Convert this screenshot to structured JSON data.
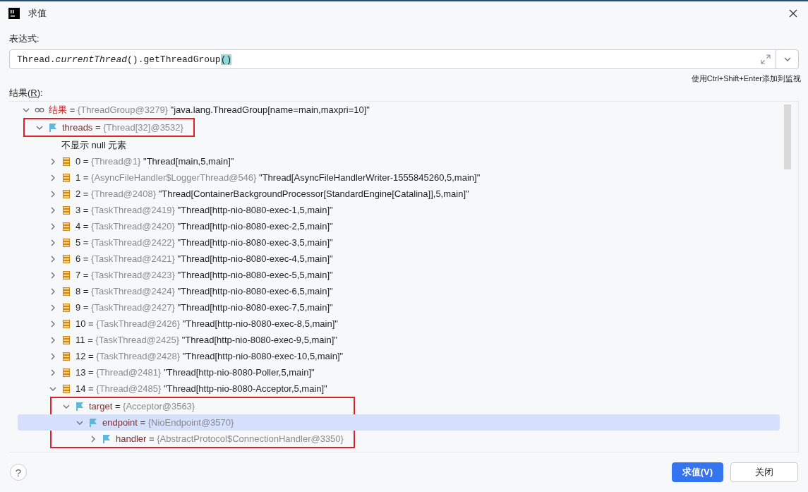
{
  "window": {
    "title": "求值"
  },
  "expression": {
    "label": "表达式:",
    "segments": [
      {
        "kind": "plain",
        "text": "Thread."
      },
      {
        "kind": "italic",
        "text": "currentThread"
      },
      {
        "kind": "plain",
        "text": "().getThreadGroup"
      },
      {
        "kind": "match",
        "text": "()"
      }
    ]
  },
  "hint": "使用Ctrl+Shift+Enter添加到监视",
  "result_label": {
    "before": "结果(",
    "mnemonic": "R",
    "after": "):"
  },
  "tree": [
    {
      "kind": "root",
      "name": "结果",
      "equals": "=",
      "type": "{ThreadGroup@3279}",
      "value": "\"java.lang.ThreadGroup[name=main,maxpri=10]\"",
      "expanded": true,
      "selected": false,
      "boxed": false,
      "children": [
        {
          "kind": "field",
          "name": "threads",
          "equals": "=",
          "type": "{Thread[32]@3532}",
          "expanded": true,
          "selected": false,
          "boxed": true,
          "children": [
            {
              "kind": "note",
              "name": "不显示 null 元素",
              "selected": false,
              "boxed": false
            },
            {
              "kind": "element",
              "name": "0",
              "equals": "=",
              "type": "{Thread@1}",
              "value": "\"Thread[main,5,main]\"",
              "expanded": false,
              "selected": false,
              "boxed": false
            },
            {
              "kind": "element",
              "name": "1",
              "equals": "=",
              "type": "{AsyncFileHandler$LoggerThread@546}",
              "value": "\"Thread[AsyncFileHandlerWriter-1555845260,5,main]\"",
              "expanded": false,
              "selected": false,
              "boxed": false
            },
            {
              "kind": "element",
              "name": "2",
              "equals": "=",
              "type": "{Thread@2408}",
              "value": "\"Thread[ContainerBackgroundProcessor[StandardEngine[Catalina]],5,main]\"",
              "expanded": false,
              "selected": false,
              "boxed": false
            },
            {
              "kind": "element",
              "name": "3",
              "equals": "=",
              "type": "{TaskThread@2419}",
              "value": "\"Thread[http-nio-8080-exec-1,5,main]\"",
              "expanded": false,
              "selected": false,
              "boxed": false
            },
            {
              "kind": "element",
              "name": "4",
              "equals": "=",
              "type": "{TaskThread@2420}",
              "value": "\"Thread[http-nio-8080-exec-2,5,main]\"",
              "expanded": false,
              "selected": false,
              "boxed": false
            },
            {
              "kind": "element",
              "name": "5",
              "equals": "=",
              "type": "{TaskThread@2422}",
              "value": "\"Thread[http-nio-8080-exec-3,5,main]\"",
              "expanded": false,
              "selected": false,
              "boxed": false
            },
            {
              "kind": "element",
              "name": "6",
              "equals": "=",
              "type": "{TaskThread@2421}",
              "value": "\"Thread[http-nio-8080-exec-4,5,main]\"",
              "expanded": false,
              "selected": false,
              "boxed": false
            },
            {
              "kind": "element",
              "name": "7",
              "equals": "=",
              "type": "{TaskThread@2423}",
              "value": "\"Thread[http-nio-8080-exec-5,5,main]\"",
              "expanded": false,
              "selected": false,
              "boxed": false
            },
            {
              "kind": "element",
              "name": "8",
              "equals": "=",
              "type": "{TaskThread@2424}",
              "value": "\"Thread[http-nio-8080-exec-6,5,main]\"",
              "expanded": false,
              "selected": false,
              "boxed": false
            },
            {
              "kind": "element",
              "name": "9",
              "equals": "=",
              "type": "{TaskThread@2427}",
              "value": "\"Thread[http-nio-8080-exec-7,5,main]\"",
              "expanded": false,
              "selected": false,
              "boxed": false
            },
            {
              "kind": "element",
              "name": "10",
              "equals": "=",
              "type": "{TaskThread@2426}",
              "value": "\"Thread[http-nio-8080-exec-8,5,main]\"",
              "expanded": false,
              "selected": false,
              "boxed": false
            },
            {
              "kind": "element",
              "name": "11",
              "equals": "=",
              "type": "{TaskThread@2425}",
              "value": "\"Thread[http-nio-8080-exec-9,5,main]\"",
              "expanded": false,
              "selected": false,
              "boxed": false
            },
            {
              "kind": "element",
              "name": "12",
              "equals": "=",
              "type": "{TaskThread@2428}",
              "value": "\"Thread[http-nio-8080-exec-10,5,main]\"",
              "expanded": false,
              "selected": false,
              "boxed": false
            },
            {
              "kind": "element",
              "name": "13",
              "equals": "=",
              "type": "{Thread@2481}",
              "value": "\"Thread[http-nio-8080-Poller,5,main]\"",
              "expanded": false,
              "selected": false,
              "boxed": false
            },
            {
              "kind": "element",
              "name": "14",
              "equals": "=",
              "type": "{Thread@2485}",
              "value": "\"Thread[http-nio-8080-Acceptor,5,main]\"",
              "expanded": true,
              "selected": false,
              "boxed": false,
              "children": [
                {
                  "kind": "field",
                  "name": "target",
                  "equals": "=",
                  "type": "{Acceptor@3563}",
                  "expanded": true,
                  "selected": false,
                  "boxed": true,
                  "children": [
                    {
                      "kind": "field",
                      "name": "endpoint",
                      "equals": "=",
                      "type": "{NioEndpoint@3570}",
                      "expanded": true,
                      "selected": true,
                      "boxed": true,
                      "children": [
                        {
                          "kind": "field",
                          "name": "handler",
                          "equals": "=",
                          "type": "{AbstractProtocol$ConnectionHandler@3350}",
                          "expanded": false,
                          "selected": false,
                          "boxed": true
                        }
                      ]
                    }
                  ]
                }
              ]
            }
          ]
        }
      ]
    }
  ],
  "help": "?",
  "buttons": [
    {
      "label": "求值(V)",
      "kind": "primary"
    },
    {
      "label": "关闭",
      "kind": "secondary"
    }
  ]
}
